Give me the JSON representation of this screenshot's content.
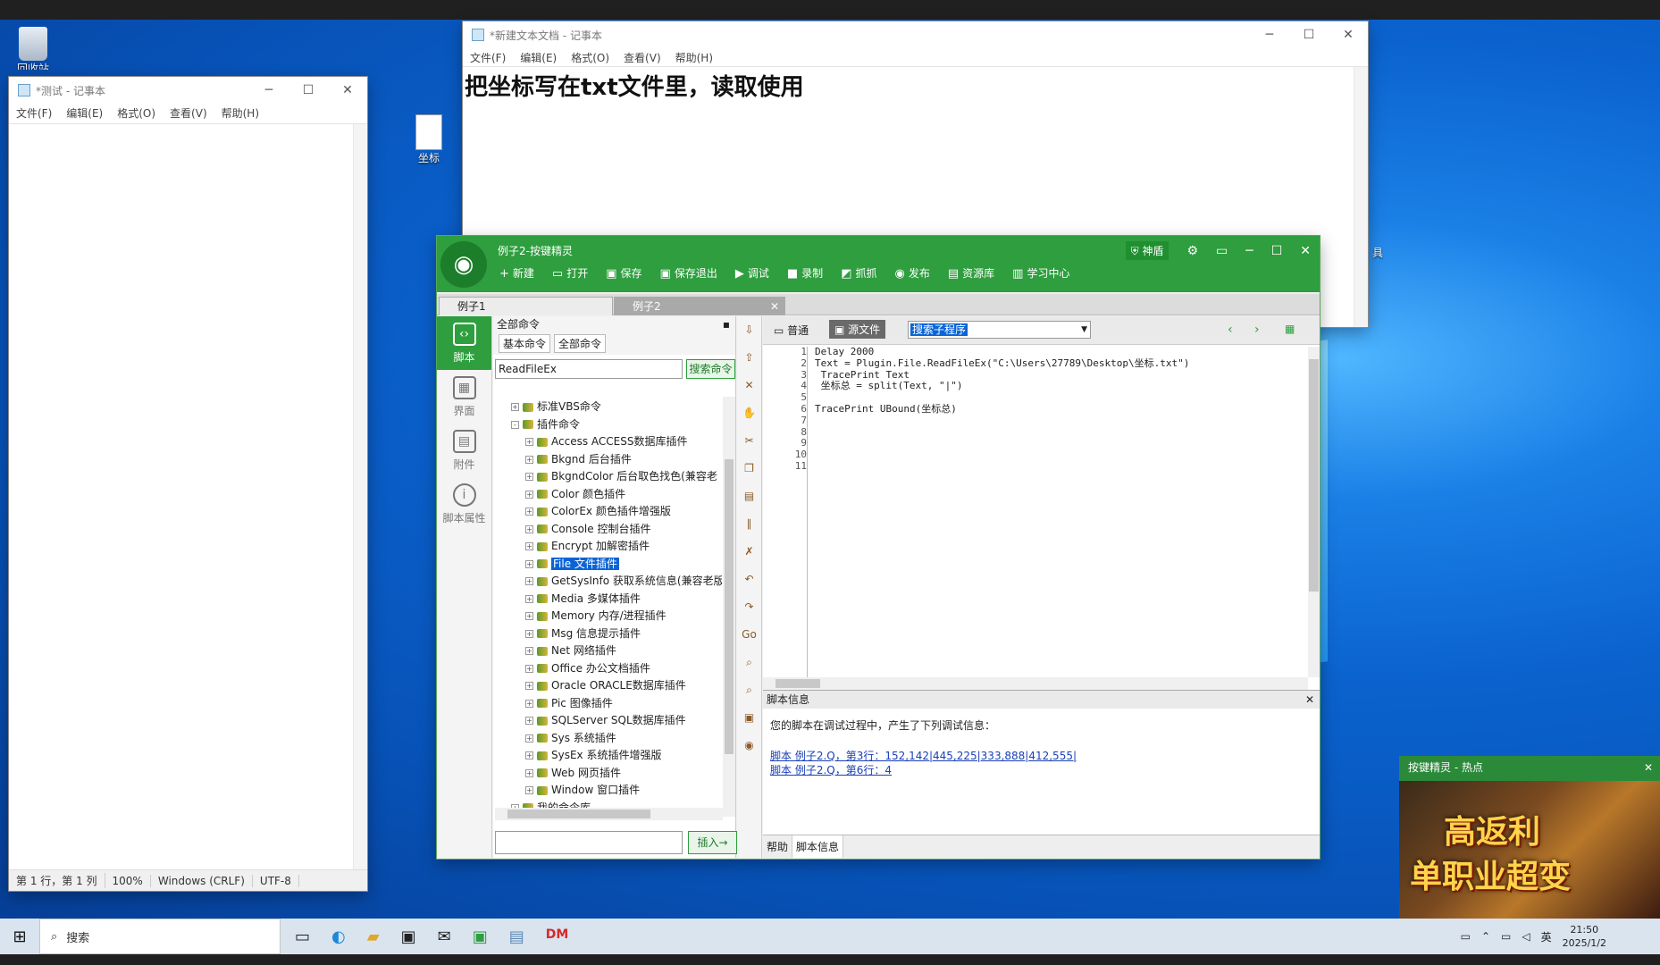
{
  "desktop": {
    "recycle_label": "回收站",
    "file_label": "坐标",
    "partial_label": "具"
  },
  "notepad1": {
    "title": "*测试 - 记事本",
    "menu": [
      "文件(F)",
      "编辑(E)",
      "格式(O)",
      "查看(V)",
      "帮助(H)"
    ],
    "status": {
      "pos": "第 1 行，第 1 列",
      "zoom": "100%",
      "eol": "Windows (CRLF)",
      "enc": "UTF-8"
    }
  },
  "notepad2": {
    "title": "*新建文本文档 - 记事本",
    "menu": [
      "文件(F)",
      "编辑(E)",
      "格式(O)",
      "查看(V)",
      "帮助(H)"
    ],
    "content": "把坐标写在txt文件里，读取使用"
  },
  "anjian": {
    "title": "例子2-按键精灵",
    "shield": "神盾",
    "tools": [
      {
        "icon": "+",
        "label": "新建"
      },
      {
        "icon": "▭",
        "label": "打开"
      },
      {
        "icon": "▣",
        "label": "保存"
      },
      {
        "icon": "▣",
        "label": "保存退出"
      },
      {
        "icon": "▶",
        "label": "调试"
      },
      {
        "icon": "■",
        "label": "录制"
      },
      {
        "icon": "◩",
        "label": "抓抓"
      },
      {
        "icon": "◉",
        "label": "发布"
      },
      {
        "icon": "▤",
        "label": "资源库"
      },
      {
        "icon": "▥",
        "label": "学习中心"
      }
    ],
    "tabs": [
      "例子1",
      "例子2"
    ],
    "side": [
      "脚本",
      "界面",
      "附件",
      "脚本属性"
    ],
    "cmd_header": "全部命令",
    "cmd_tabs": [
      "基本命令",
      "全部命令"
    ],
    "search_value": "ReadFileEx",
    "search_btn": "搜索命令",
    "tree": [
      {
        "label": "标准VBS命令",
        "level": 1,
        "pm": "+"
      },
      {
        "label": "插件命令",
        "level": 1,
        "pm": "-"
      },
      {
        "label": "Access ACCESS数据库插件",
        "level": 2
      },
      {
        "label": "Bkgnd 后台插件",
        "level": 2
      },
      {
        "label": "BkgndColor 后台取色找色(兼容老",
        "level": 2
      },
      {
        "label": "Color 颜色插件",
        "level": 2
      },
      {
        "label": "ColorEx 颜色插件增强版",
        "level": 2
      },
      {
        "label": "Console 控制台插件",
        "level": 2
      },
      {
        "label": "Encrypt 加解密插件",
        "level": 2
      },
      {
        "label": "File 文件插件",
        "level": 2,
        "selected": true
      },
      {
        "label": "GetSysInfo 获取系统信息(兼容老版",
        "level": 2
      },
      {
        "label": "Media 多媒体插件",
        "level": 2
      },
      {
        "label": "Memory 内存/进程插件",
        "level": 2
      },
      {
        "label": "Msg 信息提示插件",
        "level": 2
      },
      {
        "label": "Net 网络插件",
        "level": 2
      },
      {
        "label": "Office 办公文档插件",
        "level": 2
      },
      {
        "label": "Oracle ORACLE数据库插件",
        "level": 2
      },
      {
        "label": "Pic 图像插件",
        "level": 2
      },
      {
        "label": "SQLServer SQL数据库插件",
        "level": 2
      },
      {
        "label": "Sys 系统插件",
        "level": 2
      },
      {
        "label": "SysEx 系统插件增强版",
        "level": 2
      },
      {
        "label": "Web 网页插件",
        "level": 2
      },
      {
        "label": "Window 窗口插件",
        "level": 2
      },
      {
        "label": "我的命令库",
        "level": 1,
        "pm": "+"
      }
    ],
    "insert_btn": "插入→",
    "editor": {
      "mode_normal": "普通",
      "mode_source": "源文件",
      "sub_search": "搜索子程序",
      "line_numbers": [
        "1",
        "2",
        "3",
        "4",
        "5",
        "6",
        "7",
        "8",
        "9",
        "10",
        "11"
      ],
      "code": [
        "Delay 2000",
        "Text = Plugin.File.ReadFileEx(\"C:\\Users\\27789\\Desktop\\坐标.txt\")",
        " TracePrint Text",
        " 坐标总 = split(Text, \"|\")",
        "",
        "TracePrint UBound(坐标总)",
        "",
        "",
        "",
        "",
        ""
      ]
    },
    "info": {
      "header": "脚本信息",
      "message": "您的脚本在调试过程中，产生了下列调试信息：",
      "lines": [
        "脚本 例子2.Q，第3行：152,142|445,225|333,888|412,555|",
        "脚本 例子2.Q，第6行：4"
      ],
      "tabs": [
        "帮助",
        "脚本信息"
      ]
    }
  },
  "popup": {
    "title": "按键精灵 - 热点",
    "ad_line1": "高返利",
    "ad_line2": "单职业超变"
  },
  "taskbar": {
    "search": "搜索",
    "app_label": "DM",
    "ime": "英",
    "time": "21:50",
    "date": "2025/1/2"
  }
}
